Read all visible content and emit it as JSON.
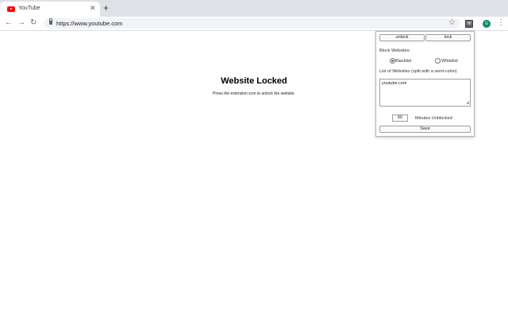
{
  "browser": {
    "tab": {
      "title": "YouTube",
      "close": "✕"
    },
    "new_tab": "+",
    "nav": {
      "back": "←",
      "forward": "→",
      "reload": "↻"
    },
    "url": "https://www.youtube.com",
    "star": "☆",
    "extension_icon": "W",
    "avatar_letter": "G",
    "menu": "⋮"
  },
  "page": {
    "title": "Website Locked",
    "subtitle": "Press the extension icon to unlock the website."
  },
  "popup": {
    "unlock_label": "unlock",
    "lock_label": "lock",
    "block_websites_label": "Block Websites:",
    "mode_options": [
      {
        "label": "Blacklist",
        "checked": true
      },
      {
        "label": "Whitelist",
        "checked": false
      }
    ],
    "list_label": "List of Websites (split with a semi-colon)",
    "websites_value": "youtube.com",
    "minutes_value": "60",
    "minutes_label": "Minutes Unblocked",
    "save_label": "Save"
  },
  "colors": {
    "tab_bg": "#dee1e6",
    "favicon_red": "#ff0000",
    "avatar_green": "#0f8a6d"
  }
}
